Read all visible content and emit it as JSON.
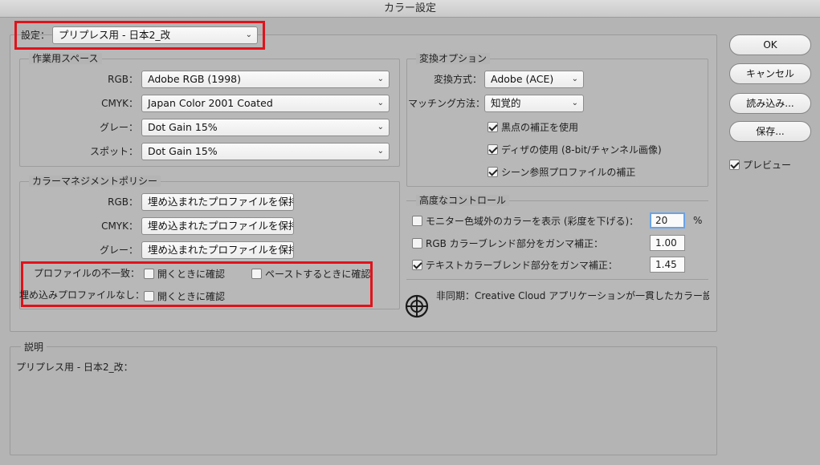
{
  "window": {
    "title": "カラー設定"
  },
  "settings": {
    "label": "設定：",
    "value": "プリプレス用 - 日本2_改"
  },
  "working_spaces": {
    "title": "作業用スペース",
    "rgb": {
      "label": "RGB：",
      "value": "Adobe RGB (1998)"
    },
    "cmyk": {
      "label": "CMYK：",
      "value": "Japan Color 2001 Coated"
    },
    "gray": {
      "label": "グレー：",
      "value": "Dot Gain 15%"
    },
    "spot": {
      "label": "スポット：",
      "value": "Dot Gain 15%"
    }
  },
  "policies": {
    "title": "カラーマネジメントポリシー",
    "rgb": {
      "label": "RGB：",
      "value": "埋め込まれたプロファイルを保持"
    },
    "cmyk": {
      "label": "CMYK：",
      "value": "埋め込まれたプロファイルを保持"
    },
    "gray": {
      "label": "グレー：",
      "value": "埋め込まれたプロファイルを保持"
    },
    "mismatch": {
      "label": "プロファイルの不一致：",
      "ask_open": "開くときに確認",
      "ask_paste": "ペーストするときに確認"
    },
    "missing": {
      "label": "埋め込みプロファイルなし：",
      "ask_open": "開くときに確認"
    }
  },
  "conversion": {
    "title": "変換オプション",
    "engine": {
      "label": "変換方式：",
      "value": "Adobe (ACE)"
    },
    "intent": {
      "label": "マッチング方法：",
      "value": "知覚的"
    },
    "black_point": "黒点の補正を使用",
    "dither": "ディザの使用 (8-bit/チャンネル画像)",
    "scene_referred": "シーン参照プロファイルの補正"
  },
  "advanced": {
    "title": "高度なコントロール",
    "desaturate": {
      "label": "モニター色域外のカラーを表示 (彩度を下げる)：",
      "value": "20",
      "unit": "%"
    },
    "rgb_gamma": {
      "label": "RGB カラーブレンド部分をガンマ補正：",
      "value": "1.00"
    },
    "text_gamma": {
      "label": "テキストカラーブレンド部分をガンマ補正：",
      "value": "1.45"
    }
  },
  "sync": {
    "text": "非同期：Creative Cloud アプリケーションが一貫したカラー設定に…"
  },
  "description": {
    "title": "説明",
    "text": "プリプレス用 - 日本2_改："
  },
  "buttons": {
    "ok": "OK",
    "cancel": "キャンセル",
    "load": "読み込み...",
    "save": "保存...",
    "preview": "プレビュー"
  },
  "checks": {
    "mismatch_open": false,
    "mismatch_paste": false,
    "missing_open": false,
    "black_point": true,
    "dither": true,
    "scene_referred": true,
    "desaturate": false,
    "rgb_gamma": false,
    "text_gamma": true,
    "preview": true
  }
}
